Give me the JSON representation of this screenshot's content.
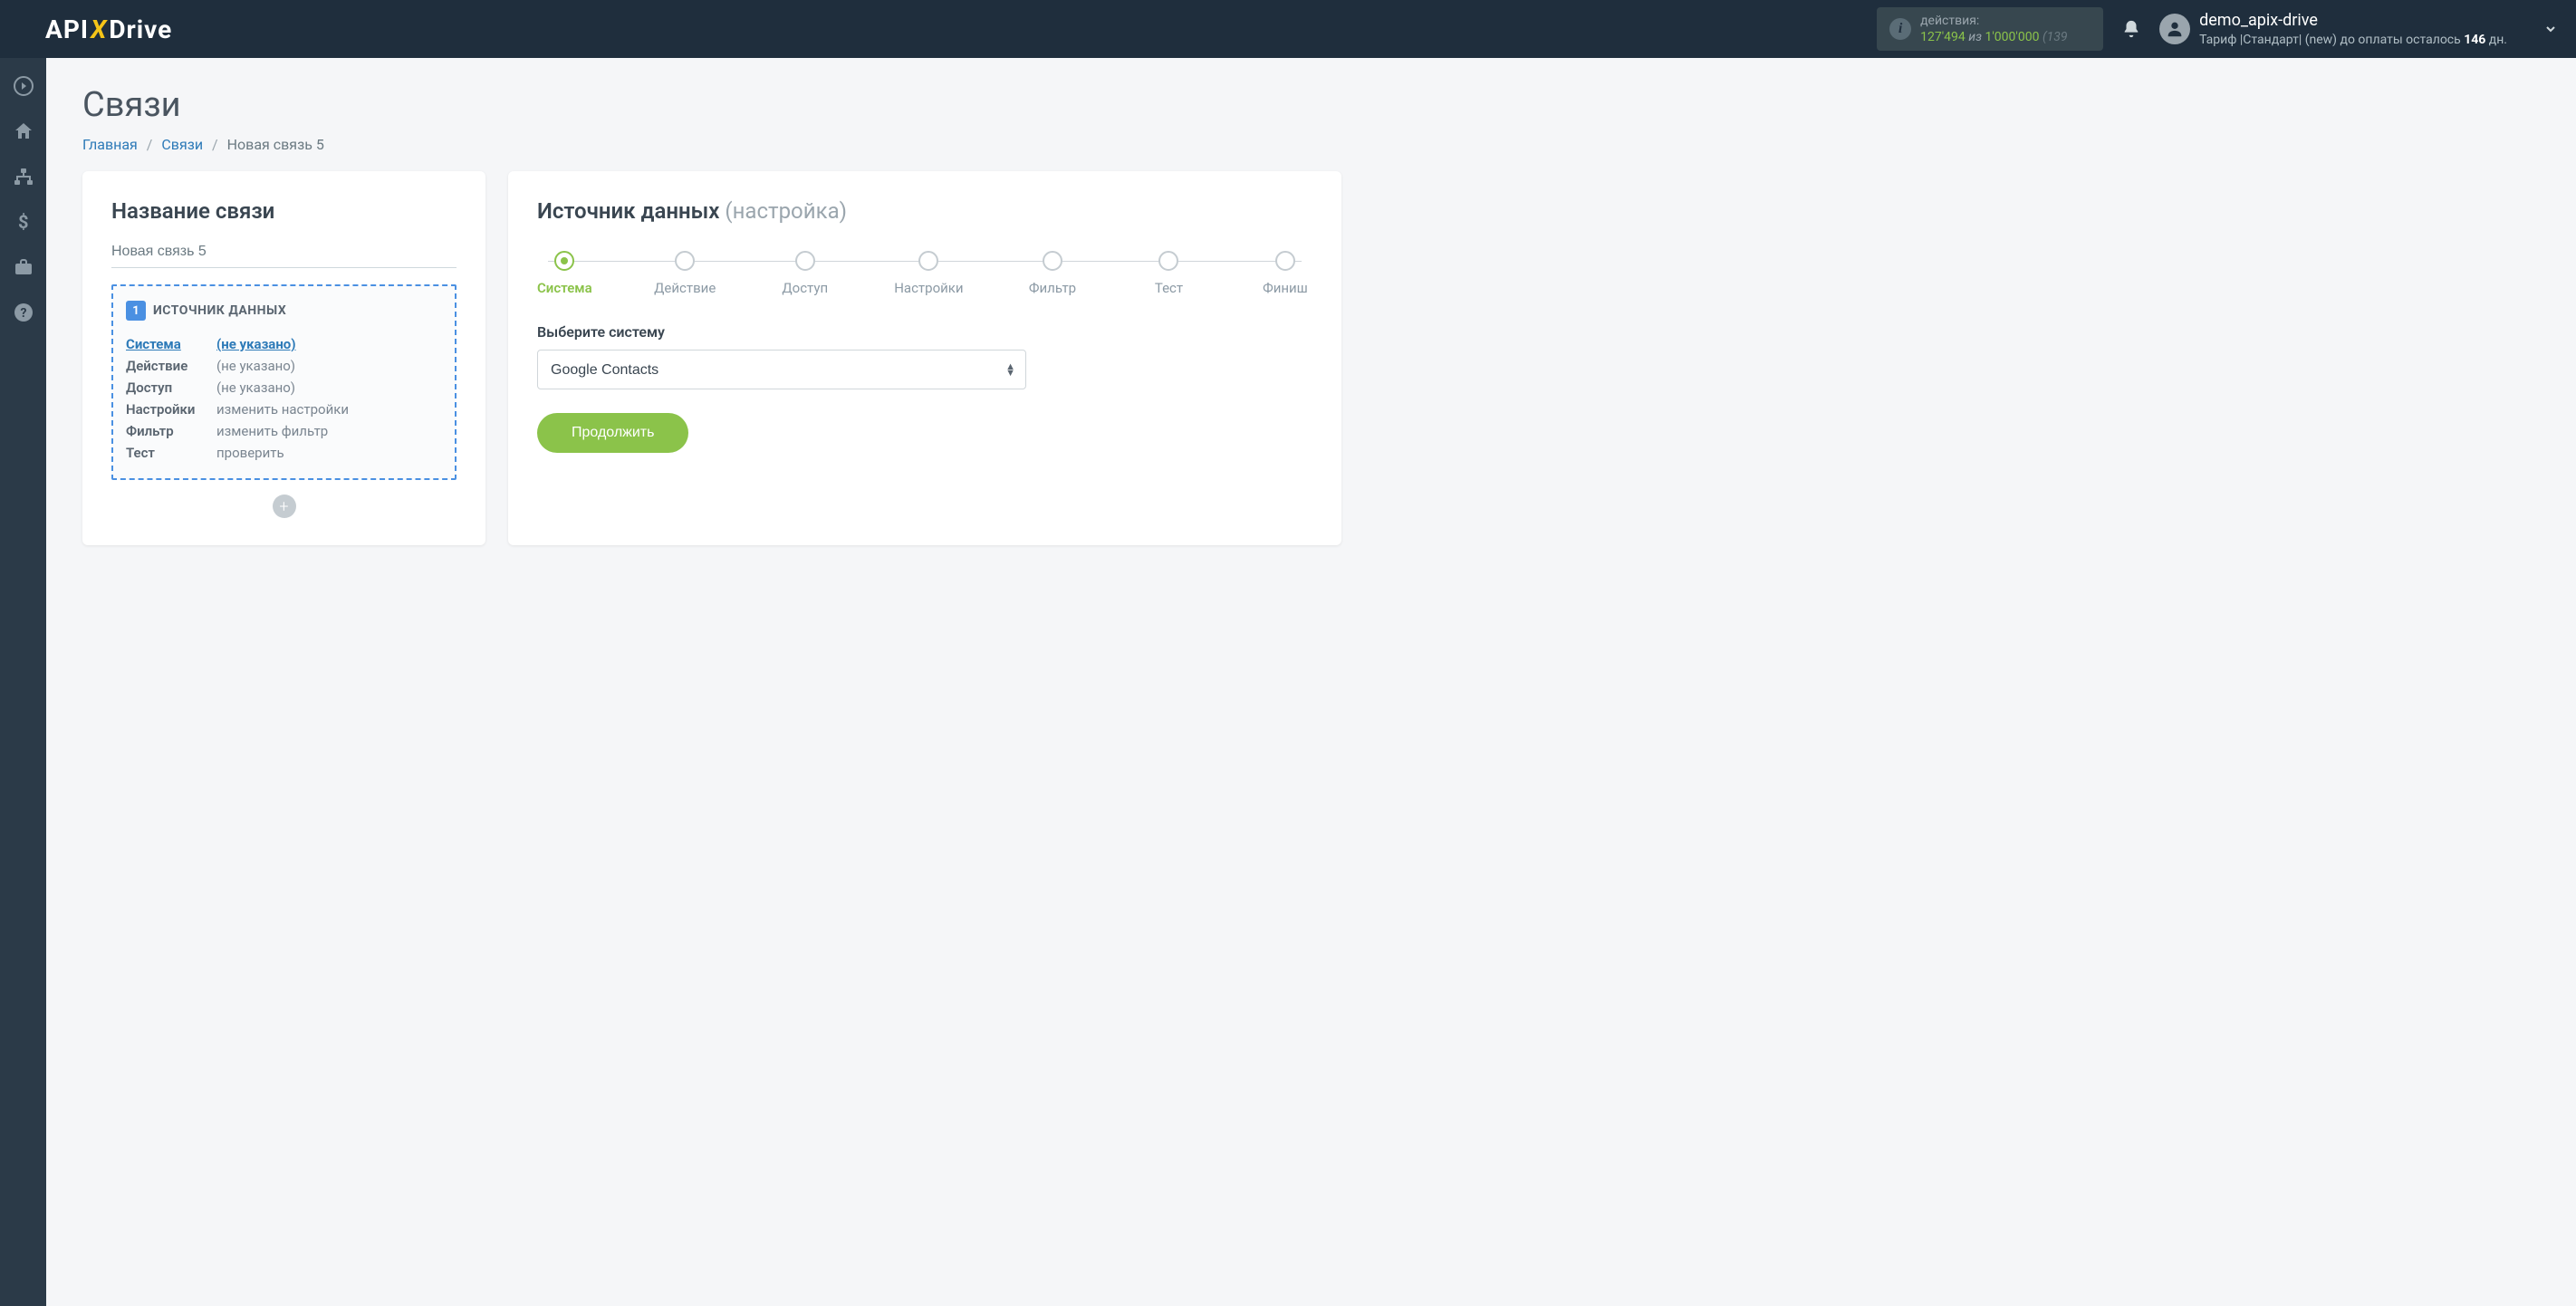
{
  "header": {
    "logo": {
      "part1": "API",
      "part2": "X",
      "part3": "Drive"
    },
    "actions": {
      "label": "действия:",
      "count": "127'494",
      "of": "из",
      "total": "1'000'000",
      "suffix": "(139"
    },
    "user": {
      "name": "demo_apix-drive",
      "plan_prefix": "Тариф |Стандарт| (new) до оплаты осталось ",
      "days": "146",
      "days_suffix": " дн."
    }
  },
  "page": {
    "title": "Связи",
    "breadcrumb": {
      "home": "Главная",
      "links": "Связи",
      "current": "Новая связь 5"
    }
  },
  "left": {
    "title": "Название связи",
    "name_value": "Новая связь 5",
    "box": {
      "num": "1",
      "title": "ИСТОЧНИК ДАННЫХ"
    },
    "rows": [
      {
        "label": "Система",
        "value": "(не указано)",
        "active": true
      },
      {
        "label": "Действие",
        "value": "(не указано)",
        "active": false
      },
      {
        "label": "Доступ",
        "value": "(не указано)",
        "active": false
      },
      {
        "label": "Настройки",
        "value": "изменить настройки",
        "active": false
      },
      {
        "label": "Фильтр",
        "value": "изменить фильтр",
        "active": false
      },
      {
        "label": "Тест",
        "value": "проверить",
        "active": false
      }
    ]
  },
  "right": {
    "title": "Источник данных ",
    "title_dim": "(настройка)",
    "steps": [
      {
        "label": "Система",
        "active": true
      },
      {
        "label": "Действие",
        "active": false
      },
      {
        "label": "Доступ",
        "active": false
      },
      {
        "label": "Настройки",
        "active": false
      },
      {
        "label": "Фильтр",
        "active": false
      },
      {
        "label": "Тест",
        "active": false
      },
      {
        "label": "Финиш",
        "active": false
      }
    ],
    "field_label": "Выберите систему",
    "select_value": "Google Contacts",
    "continue": "Продолжить"
  }
}
